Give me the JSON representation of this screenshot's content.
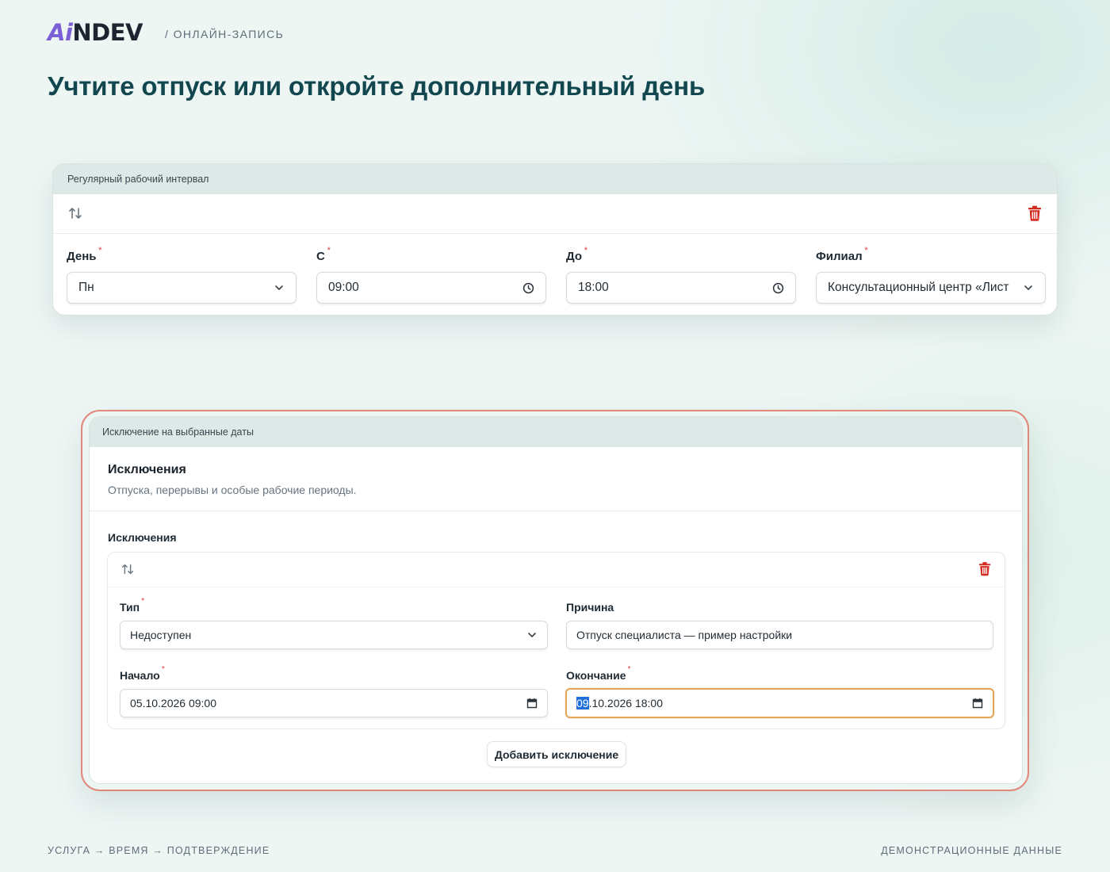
{
  "header": {
    "logo": {
      "part1": "A",
      "part2": "i",
      "part3": "NDEV"
    },
    "breadcrumb": "/ ОНЛАЙН-ЗАПИСЬ"
  },
  "page_title": "Учтите отпуск или откройте дополнительный день",
  "regular_interval": {
    "card_title": "Регулярный рабочий интервал",
    "day": {
      "label": "День",
      "value": "Пн"
    },
    "from": {
      "label": "С",
      "value": "09:00"
    },
    "to": {
      "label": "До",
      "value": "18:00"
    },
    "branch": {
      "label": "Филиал",
      "value": "Консультационный центр «Лист"
    },
    "required_mark": "*"
  },
  "exceptions": {
    "card_title": "Исключение на выбранные даты",
    "section_title": "Исключения",
    "section_description": "Отпуска, перерывы и особые рабочие периоды.",
    "list_label": "Исключения",
    "item": {
      "type": {
        "label": "Тип",
        "value": "Недоступен"
      },
      "reason": {
        "label": "Причина",
        "value": "Отпуск специалиста — пример настройки"
      },
      "start": {
        "label": "Начало",
        "value": "05.10.2026 09:00"
      },
      "end": {
        "label": "Окончание",
        "value_selected": "09",
        "value_rest": ".10.2026 18:00"
      }
    },
    "add_button": "Добавить исключение"
  },
  "footer": {
    "steps": "УСЛУГА → ВРЕМЯ → ПОДТВЕРЖДЕНИЕ",
    "note": "ДЕМОНСТРАЦИОННЫЕ ДАННЫЕ"
  },
  "colors": {
    "title": "#12474f",
    "accent_logo": "#7b5fd6",
    "required": "#e0362c",
    "delete": "#d42a20",
    "highlight_outline": "#e0897a",
    "focus": "#e2a55a"
  },
  "icons": [
    "sort-icon",
    "trash-icon",
    "chevron-down-icon",
    "clock-icon",
    "calendar-icon"
  ]
}
